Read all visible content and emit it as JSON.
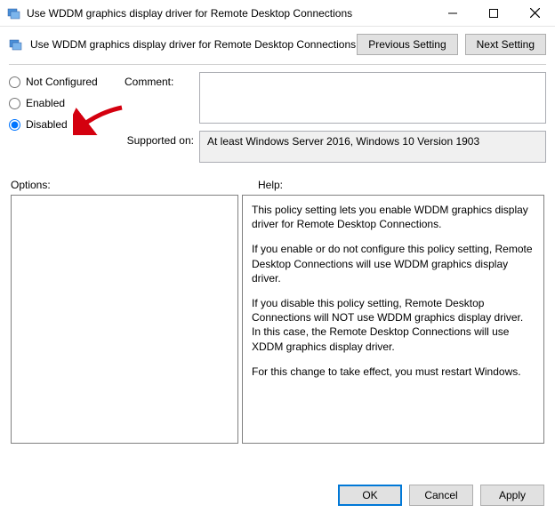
{
  "window": {
    "title": "Use WDDM graphics display driver for Remote Desktop Connections"
  },
  "header": {
    "policy_name": "Use WDDM graphics display driver for Remote Desktop Connections",
    "previous_label": "Previous Setting",
    "next_label": "Next Setting"
  },
  "config": {
    "not_configured_label": "Not Configured",
    "enabled_label": "Enabled",
    "disabled_label": "Disabled",
    "comment_label": "Comment:",
    "comment_value": "",
    "supported_label": "Supported on:",
    "supported_value": "At least Windows Server 2016, Windows 10 Version 1903",
    "selected": "disabled"
  },
  "panels": {
    "options_label": "Options:",
    "help_label": "Help:"
  },
  "help": {
    "p1": "This policy setting lets you enable WDDM graphics display driver for Remote Desktop Connections.",
    "p2": "If you enable or do not configure this policy setting, Remote Desktop Connections will use WDDM graphics display driver.",
    "p3": "If you disable this policy setting, Remote Desktop Connections will NOT use WDDM graphics display driver. In this case, the Remote Desktop Connections will use XDDM graphics display driver.",
    "p4": "For this change to take effect, you must restart Windows."
  },
  "footer": {
    "ok_label": "OK",
    "cancel_label": "Cancel",
    "apply_label": "Apply"
  }
}
